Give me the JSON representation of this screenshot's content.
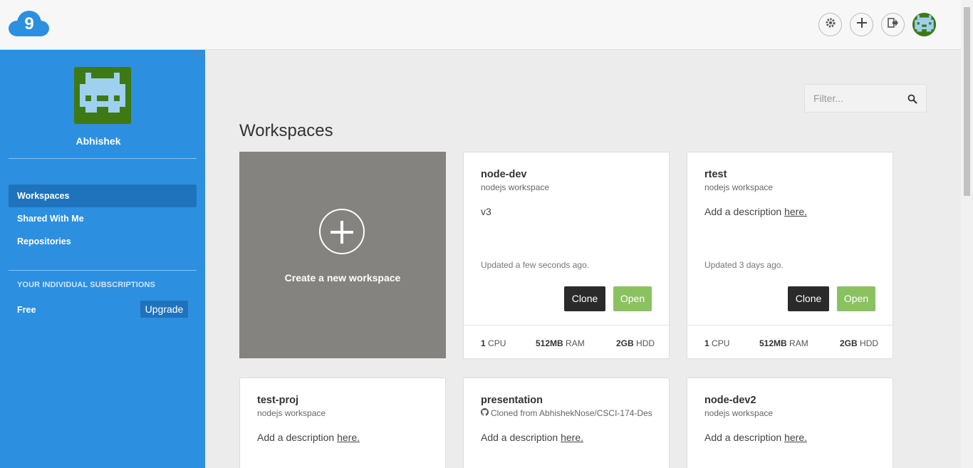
{
  "colors": {
    "sidebar": "#2c8fe0",
    "sidebar_active": "#1f73bd",
    "create_card": "#858380",
    "clone_button": "#2a2a2a",
    "open_button": "#8bc260",
    "logo": "#2c8fe0"
  },
  "header": {
    "logo_icon": "cloud9-logo",
    "actions": [
      "gear-icon",
      "plus-icon",
      "logout-icon",
      "avatar"
    ]
  },
  "sidebar": {
    "user_name": "Abhishek",
    "nav": [
      {
        "label": "Workspaces",
        "active": true
      },
      {
        "label": "Shared With Me",
        "active": false
      },
      {
        "label": "Repositories",
        "active": false
      }
    ],
    "subscriptions_heading": "YOUR INDIVIDUAL SUBSCRIPTIONS",
    "plan_name": "Free",
    "upgrade_label": "Upgrade"
  },
  "filter": {
    "placeholder": "Filter..."
  },
  "main": {
    "title": "Workspaces",
    "create_label": "Create a new workspace",
    "workspaces": [
      {
        "name": "node-dev",
        "type": "nodejs workspace",
        "description": "v3",
        "updated": "Updated a few seconds ago.",
        "clone_label": "Clone",
        "open_label": "Open",
        "cpu": "1",
        "cpu_unit": "CPU",
        "ram": "512MB",
        "ram_unit": "RAM",
        "hdd": "2GB",
        "hdd_unit": "HDD"
      },
      {
        "name": "rtest",
        "type": "nodejs workspace",
        "description_prefix": "Add a description ",
        "description_link": "here.",
        "updated": "Updated 3 days ago.",
        "clone_label": "Clone",
        "open_label": "Open",
        "cpu": "1",
        "cpu_unit": "CPU",
        "ram": "512MB",
        "ram_unit": "RAM",
        "hdd": "2GB",
        "hdd_unit": "HDD"
      },
      {
        "name": "test-proj",
        "type": "nodejs workspace",
        "description_prefix": "Add a description ",
        "description_link": "here."
      },
      {
        "name": "presentation",
        "type": "Cloned from AbhishekNose/CSCI-174-Des",
        "type_icon": "github-icon",
        "description_prefix": "Add a description ",
        "description_link": "here."
      },
      {
        "name": "node-dev2",
        "type": "nodejs workspace",
        "description_prefix": "Add a description ",
        "description_link": "here."
      }
    ]
  }
}
